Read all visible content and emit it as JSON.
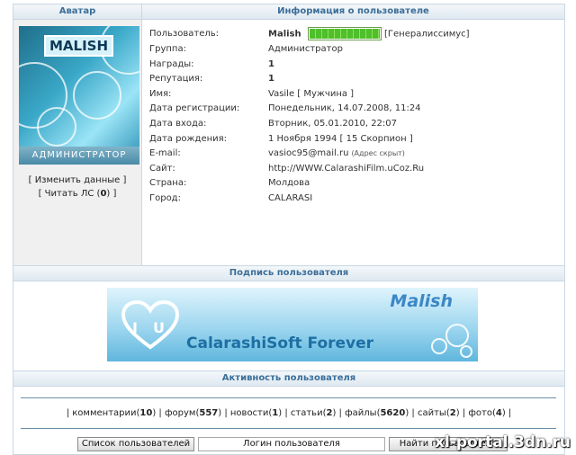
{
  "left_column": {
    "header": "Аватар",
    "avatar": {
      "logo_text": "MALISH",
      "caption": "АДМИНИСТРАТОР"
    },
    "edit_link": "Изменить данные",
    "pm_link_prefix": "Читать ЛС (",
    "pm_count": "0",
    "pm_link_suffix": ")"
  },
  "right_column": {
    "header": "Информация о пользователе",
    "user": {
      "label": "Пользователь:",
      "name": "Malish",
      "rank_percent": 100,
      "rank_title": "[Генералиссимус]"
    },
    "rows": [
      {
        "label": "Группа:",
        "value": "Администратор"
      },
      {
        "label": "Награды:",
        "value": "1"
      },
      {
        "label": "Репутация:",
        "value": "1"
      },
      {
        "label": "Имя:",
        "value": "Vasile [ Мужчина ]"
      },
      {
        "label": "Дата регистрации:",
        "value": "Понедельник, 14.07.2008, 11:24"
      },
      {
        "label": "Дата входа:",
        "value": "Вторник, 05.01.2010, 22:07"
      },
      {
        "label": "Дата рождения:",
        "value": "1 Ноября 1994 [ 15 Скорпион ]"
      },
      {
        "label": "E-mail:",
        "value": "vasioc95@mail.ru",
        "note": "(Адрес скрыт)"
      },
      {
        "label": "Сайт:",
        "value": "http://WWW.CalarashiFilm.uCoz.Ru"
      },
      {
        "label": "Страна:",
        "value": "Молдова"
      },
      {
        "label": "Город:",
        "value": "CALARASI"
      }
    ]
  },
  "signature": {
    "header": "Подпись пользователя",
    "banner_text": "CalarashiSoft Forever",
    "banner_brand": "Malish",
    "heart_letters": [
      "I",
      "U"
    ]
  },
  "activity": {
    "header": "Активность пользователя",
    "items": [
      {
        "label": "комментарии",
        "count": "10"
      },
      {
        "label": "форум",
        "count": "557"
      },
      {
        "label": "новости",
        "count": "1"
      },
      {
        "label": "статьи",
        "count": "2"
      },
      {
        "label": "файлы",
        "count": "5620"
      },
      {
        "label": "сайты",
        "count": "2"
      },
      {
        "label": "фото",
        "count": "4"
      }
    ]
  },
  "bottom": {
    "user_list_button": "Список пользователей",
    "login_input_value": "Логин пользователя",
    "find_button": "Найти пользователя"
  },
  "watermark": "xl-portal.3dn.ru",
  "colors": {
    "header_text": "#3b6e99",
    "border": "#c9d7e3",
    "rank_bar": "#4fbf2c"
  }
}
